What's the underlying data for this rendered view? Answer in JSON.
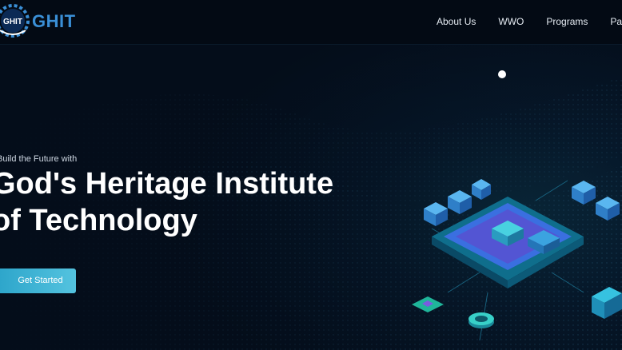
{
  "brand": {
    "name": "GHIT",
    "logo_text": "GHIT"
  },
  "nav": {
    "items": [
      "About Us",
      "WWO",
      "Programs",
      "Partners"
    ]
  },
  "hero": {
    "tagline": "Build the Future with",
    "title_line1": "God's Heritage Institute",
    "title_line2": "of Technology",
    "cta_label": "Get Started"
  },
  "colors": {
    "background": "#040d1a",
    "brand": "#3a8fd6",
    "accent": "#2aa3c9",
    "chip": "#3a6fe0"
  },
  "icons": {
    "logo": "gear-logo-icon",
    "slider_dot": "carousel-dot-icon"
  }
}
